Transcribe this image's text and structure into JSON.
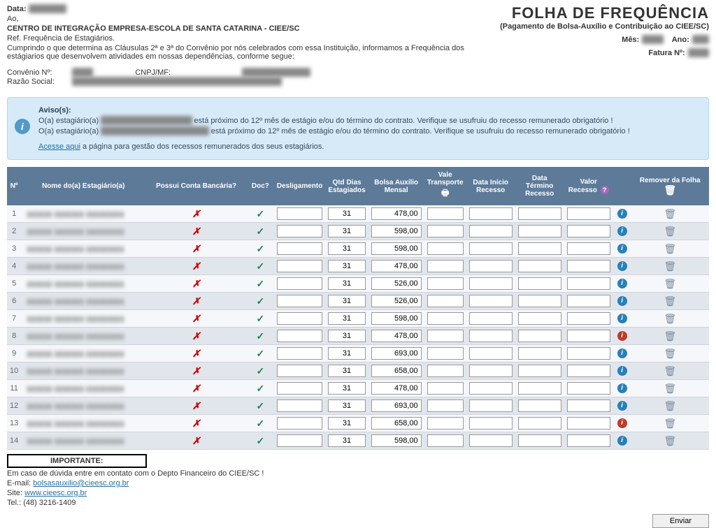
{
  "header": {
    "data_label": "Data:",
    "data_value": "▮▮/▮▮/▮▮▮▮",
    "ao": "Ao,",
    "centro": "CENTRO DE INTEGRAÇÃO EMPRESA-ESCOLA DE SANTA CATARINA - CIEE/SC",
    "ref": "Ref. Frequência de Estagiários.",
    "cumprindo": "Cumprindo o que determina as Cláusulas 2ª e 3ª do Convênio por nós celebrados com essa Instituição, informamos a Frequência dos estágiarios que desenvolvem atividades em nossas dependências, conforme segue:",
    "convenio_lbl": "Convênio Nº:",
    "convenio_val": "▮▮▮▮▮",
    "cnpj_lbl": "CNPJ/MF:",
    "cnpj_val": "▮▮.▮▮▮.▮▮▮/▮▮▮▮-▮▮",
    "razao_lbl": "Razão Social:",
    "razao_val": "▮▮▮▮▮▮ ▮▮ ▮▮▮▮▮▮▮▮▮▮ ▮▮▮▮▮▮▮ ▮▮▮▮▮▮ ▮▮ ▮▮▮▮▮ ▮▮▮▮▮▮▮▮"
  },
  "title": {
    "main": "FOLHA DE FREQUÊNCIA",
    "sub": "(Pagamento de Bolsa-Auxílio e Contribuição ao CIEE/SC)",
    "mes_lbl": "Mês:",
    "mes_val": "▮▮▮▮▮",
    "ano_lbl": "Ano:",
    "ano_val": "▮▮▮▮",
    "fatura_lbl": "Fatura Nº:",
    "fatura_val": "▮▮▮▮▮"
  },
  "aviso": {
    "title": "Aviso(s):",
    "line1a": "O(a) estagiário(a) ",
    "line1b": " está próximo do 12º mês de estágio e/ou do término do contrato. Verifique se usufruiu do recesso remunerado obrigatório !",
    "line2a": "O(a) estagiário(a) ",
    "line2b": " está próximo do 12º mês de estágio e/ou do término do contrato. Verifique se usufruiu do recesso remunerado obrigatório !",
    "link_text": "Acesse aqui",
    "link_rest": " a página para gestão dos recessos remunerados dos seus estagiários."
  },
  "columns": {
    "n": "Nº",
    "nome": "Nome do(a) Estagiário(a)",
    "possui": "Possui Conta Bancária?",
    "doc": "Doc?",
    "deslig": "Desligamento",
    "dias": "Qtd Dias Estagiados",
    "bolsa": "Bolsa Auxílio Mensal",
    "vale": "Vale Transporte",
    "di": "Data Início Recesso",
    "dt": "Data Término Recesso",
    "vr": "Valor Recesso",
    "remover": "Remover da Folha"
  },
  "rows": [
    {
      "n": "1",
      "dias": "31",
      "bolsa": "478,00",
      "info": "blue"
    },
    {
      "n": "2",
      "dias": "31",
      "bolsa": "598,00",
      "info": "blue"
    },
    {
      "n": "3",
      "dias": "31",
      "bolsa": "598,00",
      "info": "blue"
    },
    {
      "n": "4",
      "dias": "31",
      "bolsa": "478,00",
      "info": "blue"
    },
    {
      "n": "5",
      "dias": "31",
      "bolsa": "526,00",
      "info": "blue"
    },
    {
      "n": "6",
      "dias": "31",
      "bolsa": "526,00",
      "info": "blue"
    },
    {
      "n": "7",
      "dias": "31",
      "bolsa": "598,00",
      "info": "blue"
    },
    {
      "n": "8",
      "dias": "31",
      "bolsa": "478,00",
      "info": "red"
    },
    {
      "n": "9",
      "dias": "31",
      "bolsa": "693,00",
      "info": "blue"
    },
    {
      "n": "10",
      "dias": "31",
      "bolsa": "658,00",
      "info": "blue"
    },
    {
      "n": "11",
      "dias": "31",
      "bolsa": "478,00",
      "info": "blue"
    },
    {
      "n": "12",
      "dias": "31",
      "bolsa": "693,00",
      "info": "blue"
    },
    {
      "n": "13",
      "dias": "31",
      "bolsa": "658,00",
      "info": "red"
    },
    {
      "n": "14",
      "dias": "31",
      "bolsa": "598,00",
      "info": "blue"
    }
  ],
  "footer": {
    "importante": "IMPORTANTE:",
    "contato": "Em caso de dúvida entre em contato com o Depto Financeiro do CIEE/SC !",
    "email_lbl": "E-mail: ",
    "email_link": "bolsasauxilio@cieesc.org.br",
    "site_lbl": "Site: ",
    "site_link": "www.cieesc.org.br",
    "tel": "Tel.: (48) 3216-1409",
    "enviar": "Enviar"
  }
}
